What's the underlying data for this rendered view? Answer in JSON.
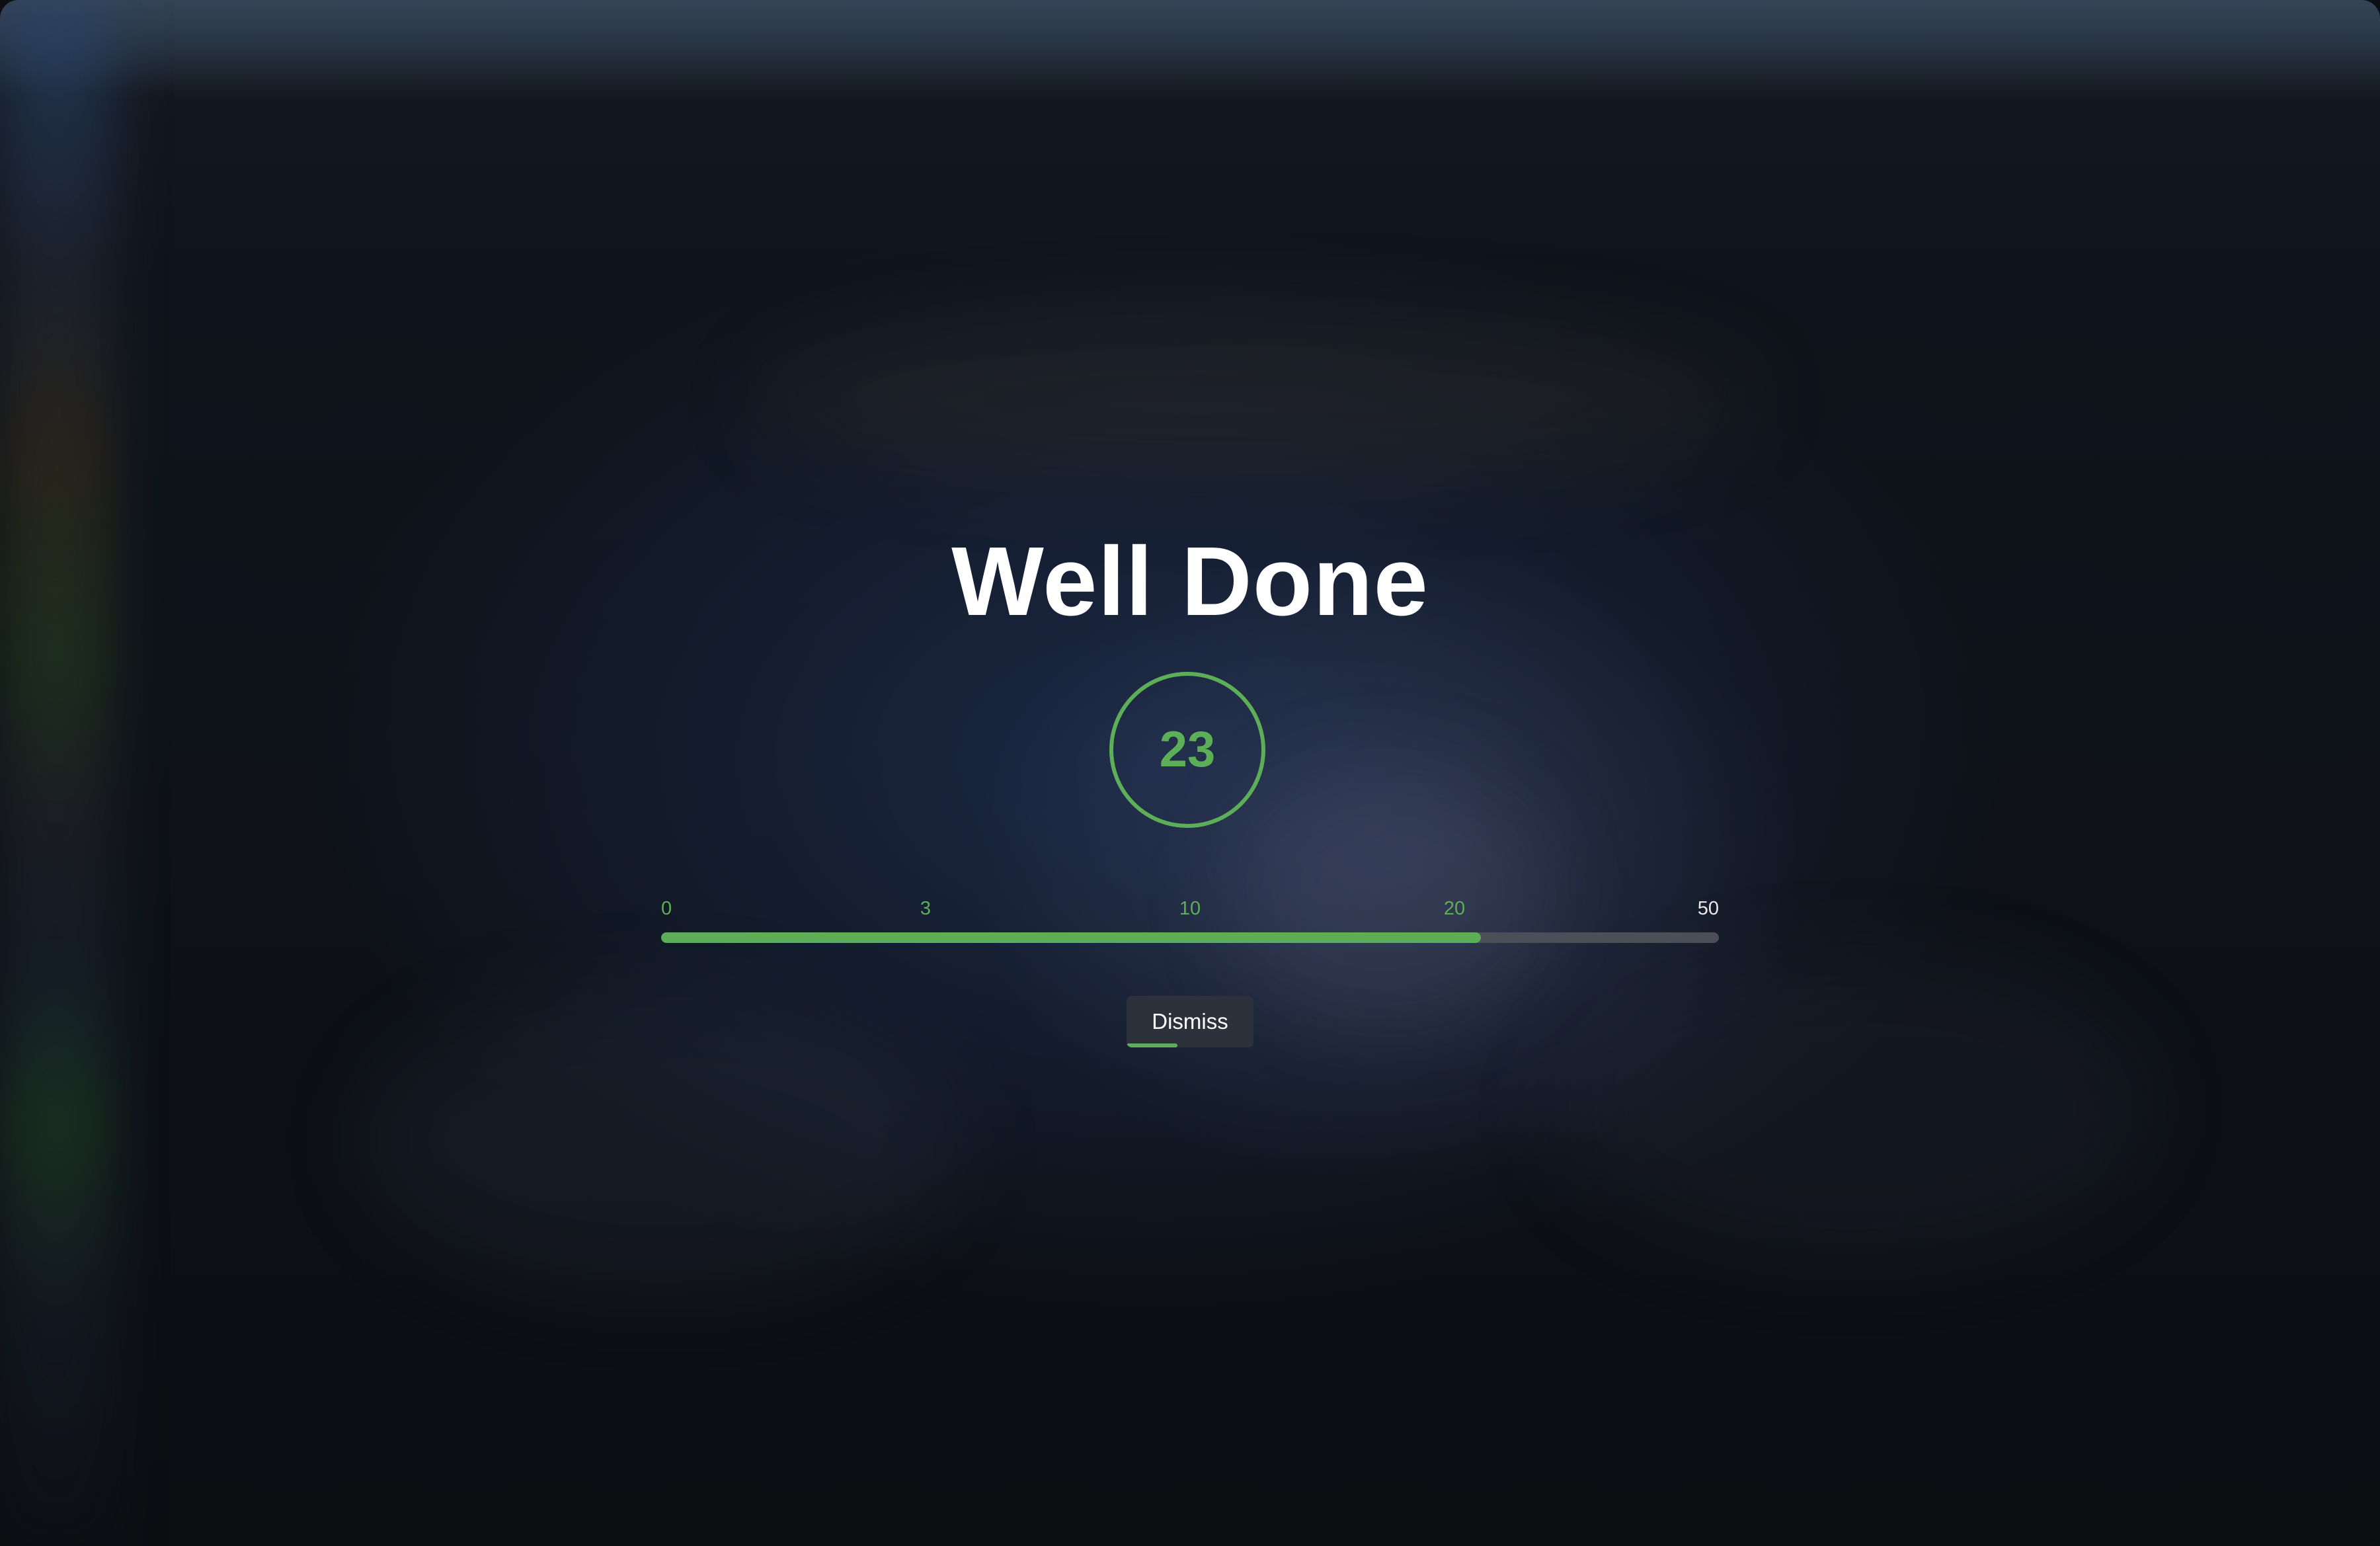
{
  "overlay": {
    "title": "Well Done",
    "score": "23",
    "scale": {
      "ticks": [
        "0",
        "3",
        "10",
        "20",
        "50"
      ],
      "progress_fraction": 0.775
    },
    "dismiss": {
      "label": "Dismiss",
      "countdown_fraction": 0.4
    }
  },
  "colors": {
    "accent": "#5cae57",
    "track": "#4a4f58",
    "button_bg": "#2c313b",
    "title": "#ffffff"
  }
}
